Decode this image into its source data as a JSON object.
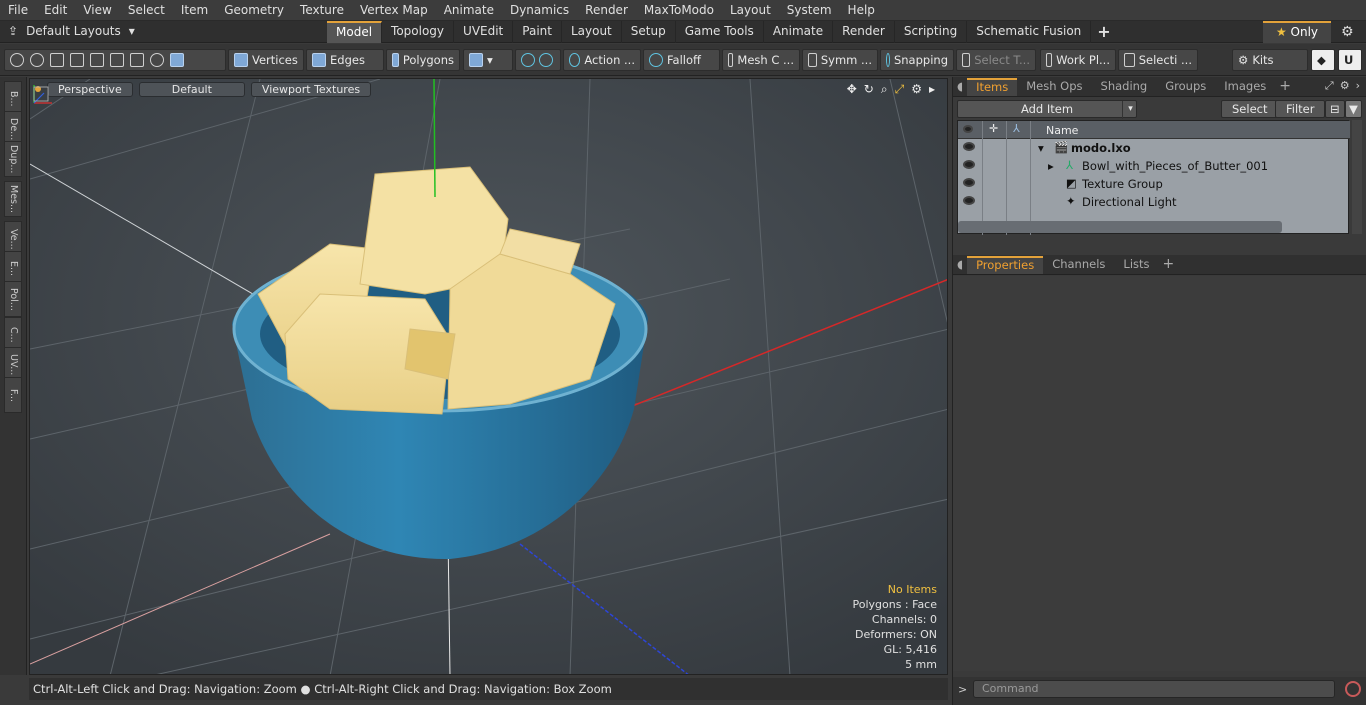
{
  "menu": [
    "File",
    "Edit",
    "View",
    "Select",
    "Item",
    "Geometry",
    "Texture",
    "Vertex Map",
    "Animate",
    "Dynamics",
    "Render",
    "MaxToModo",
    "Layout",
    "System",
    "Help"
  ],
  "layouts_label": "Default Layouts",
  "tabs": [
    "Model",
    "Topology",
    "UVEdit",
    "Paint",
    "Layout",
    "Setup",
    "Game Tools",
    "Animate",
    "Render",
    "Scripting",
    "Schematic Fusion"
  ],
  "active_tab": "Model",
  "only_label": "Only",
  "toolbar": {
    "vertices": "Vertices",
    "edges": "Edges",
    "polygons": "Polygons",
    "action": "Action ...",
    "falloff": "Falloff",
    "mesh": "Mesh C ...",
    "symm": "Symm ...",
    "snapping": "Snapping",
    "select_t": "Select T...",
    "work_pl": "Work Pl...",
    "selecti": "Selecti ...",
    "kits": "Kits"
  },
  "left_strip": [
    "B...",
    "De...",
    "Dup...",
    "Mes...",
    "Ve...",
    "E...",
    "Pol...",
    "C...",
    "UV...",
    "F..."
  ],
  "viewport": {
    "perspective": "Perspective",
    "default": "Default",
    "textures": "Viewport Textures",
    "stats": {
      "no_items": "No Items",
      "polygons": "Polygons : Face",
      "channels": "Channels: 0",
      "deformers": "Deformers: ON",
      "gl": "GL: 5,416",
      "unit": "5 mm"
    }
  },
  "status_text": "Ctrl-Alt-Left Click and Drag: Navigation: Zoom ● Ctrl-Alt-Right Click and Drag: Navigation: Box Zoom",
  "right": {
    "tabs": [
      "Items",
      "Mesh Ops",
      "Shading",
      "Groups",
      "Images"
    ],
    "active": "Items",
    "add_item": "Add Item",
    "select": "Select",
    "filter": "Filter",
    "name_col": "Name",
    "items": [
      {
        "label": "modo.lxo",
        "bold": true
      },
      {
        "label": "Bowl_with_Pieces_of_Butter_001",
        "bold": false
      },
      {
        "label": "Texture Group",
        "bold": false
      },
      {
        "label": "Directional Light",
        "bold": false
      }
    ],
    "prop_tabs": [
      "Properties",
      "Channels",
      "Lists"
    ],
    "prop_active": "Properties",
    "command_placeholder": "Command"
  },
  "colors": {
    "accent": "#e3a23a",
    "bowl": "#2e7ea8",
    "butter": "#f2dc9a"
  }
}
